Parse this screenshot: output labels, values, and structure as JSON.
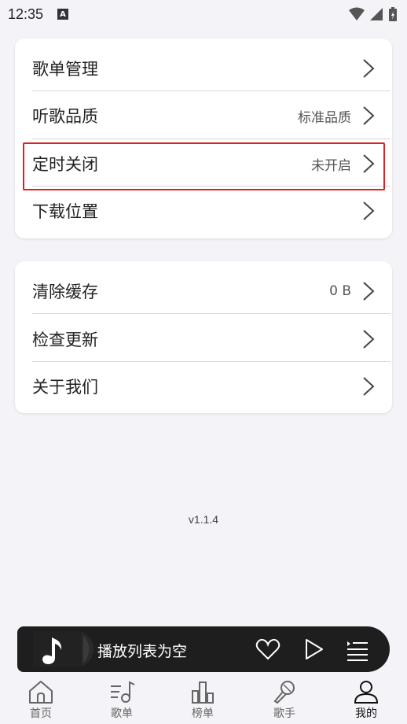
{
  "status": {
    "time": "12:35",
    "a_badge": "A"
  },
  "settings_group1": [
    {
      "label": "歌单管理",
      "value": ""
    },
    {
      "label": "听歌品质",
      "value": "标准品质"
    },
    {
      "label": "定时关闭",
      "value": "未开启"
    },
    {
      "label": "下载位置",
      "value": ""
    }
  ],
  "settings_group2": [
    {
      "label": "清除缓存",
      "value": "0 B"
    },
    {
      "label": "检查更新",
      "value": ""
    },
    {
      "label": "关于我们",
      "value": ""
    }
  ],
  "version": "v1.1.4",
  "player": {
    "title": "播放列表为空"
  },
  "tabs": [
    {
      "label": "首页",
      "icon": "home-icon"
    },
    {
      "label": "歌单",
      "icon": "playlist-icon"
    },
    {
      "label": "榜单",
      "icon": "chart-icon"
    },
    {
      "label": "歌手",
      "icon": "microphone-icon"
    },
    {
      "label": "我的",
      "icon": "user-icon"
    }
  ],
  "colors": {
    "highlight": "#e02020",
    "background": "#f3f3f8",
    "player_bg": "#1e1e1e"
  }
}
